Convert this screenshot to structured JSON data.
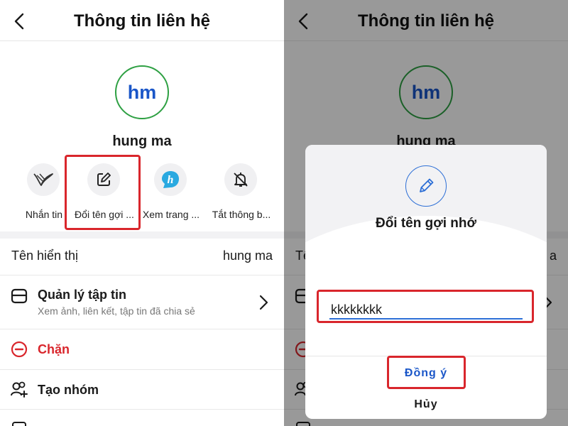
{
  "header": {
    "title": "Thông tin liên hệ"
  },
  "contact": {
    "initials": "hm",
    "name": "hung ma",
    "avatar_ring_color": "#2ea043",
    "initials_color": "#1a56c8"
  },
  "actions": [
    {
      "label": "Nhắn tin",
      "icon": "message-wave-icon"
    },
    {
      "label": "Đổi tên gợi ...",
      "icon": "edit-note-icon"
    },
    {
      "label": "Xem trang ...",
      "icon": "profile-h-icon"
    },
    {
      "label": "Tắt thông b...",
      "icon": "bell-off-icon"
    }
  ],
  "rows": {
    "display_name": {
      "label": "Tên hiển thị",
      "value": "hung ma"
    },
    "files": {
      "title": "Quản lý tập tin",
      "subtitle": "Xem ảnh, liên kết, tập tin đã chia sẻ",
      "icon": "folder-icon"
    },
    "block": {
      "title": "Chặn",
      "icon": "block-icon",
      "color": "#d9262c"
    },
    "group": {
      "title": "Tạo nhóm",
      "icon": "add-group-icon"
    }
  },
  "right_panel_partial": {
    "display_label_fragment": "Tê",
    "display_value_fragment": "a"
  },
  "dialog": {
    "title": "Đổi tên gợi nhớ",
    "icon": "pencil-icon",
    "input_value": "kkkkkkkk",
    "confirm_label": "Đồng ý",
    "cancel_label": "Hủy"
  },
  "colors": {
    "highlight": "#d9262c",
    "accent": "#2d6fd6",
    "danger": "#d9262c"
  }
}
